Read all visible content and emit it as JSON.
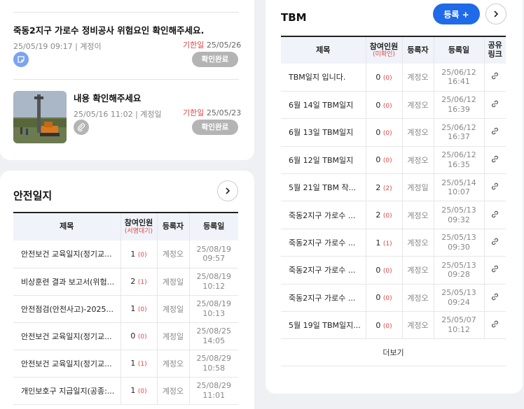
{
  "notices": [
    {
      "title": "죽동2지구 가로수 정비공사 위험요인 확인해주세요.",
      "meta": "25/05/19 09:17 | 계정이",
      "due_label": "기한일",
      "due": "25/05/26",
      "status": "확인완료",
      "attachment_icon": "memo-icon"
    },
    {
      "title": "내용 확인해주세요",
      "meta": "25/05/16 11:02 | 계정일",
      "due_label": "기한일",
      "due": "25/05/23",
      "status": "확인완료",
      "attachment_icon": "paperclip-icon"
    }
  ],
  "safety": {
    "title": "안전일지",
    "columns": {
      "title": "제목",
      "participants": "참여인원",
      "participants_sub": "(서명대기)",
      "registrant": "등록자",
      "date": "등록일"
    },
    "rows": [
      {
        "title": "안전보건 교육일지(정기교...",
        "count": "1",
        "pending": "(0)",
        "registrant": "계정오",
        "date": "25/08/19",
        "time": "09:57"
      },
      {
        "title": "비상훈련 결과 보고서(위험...",
        "count": "2",
        "pending": "(1)",
        "registrant": "계정일",
        "date": "25/08/19",
        "time": "10:12"
      },
      {
        "title": "안전점검(안전사고)-2025...",
        "count": "1",
        "pending": "(0)",
        "registrant": "계정일",
        "date": "25/08/19",
        "time": "10:13"
      },
      {
        "title": "안전보건 교육일지(정기교...",
        "count": "0",
        "pending": "(0)",
        "registrant": "계정일",
        "date": "25/08/25",
        "time": "14:05"
      },
      {
        "title": "안전보건 교육일지(정기교...",
        "count": "1",
        "pending": "(1)",
        "registrant": "계정오",
        "date": "25/08/29",
        "time": "10:58"
      },
      {
        "title": "개인보호구 지급일지(공종:...",
        "count": "1",
        "pending": "(0)",
        "registrant": "계정오",
        "date": "25/08/29",
        "time": "11:01"
      }
    ]
  },
  "tbm": {
    "title": "TBM",
    "register_label": "등록 +",
    "columns": {
      "title": "제목",
      "participants": "참여인원",
      "participants_sub": "(미확인)",
      "registrant": "등록자",
      "date": "등록일",
      "share_1": "공유",
      "share_2": "링크"
    },
    "rows": [
      {
        "title": "TBM일지 입니다.",
        "count": "0",
        "pending": "(0)",
        "registrant": "계정오",
        "date": "25/06/12",
        "time": "16:41"
      },
      {
        "title": "6월 14일 TBM일지",
        "count": "0",
        "pending": "(0)",
        "registrant": "계정오",
        "date": "25/06/12",
        "time": "16:39"
      },
      {
        "title": "6월 13일 TBM일지",
        "count": "0",
        "pending": "(0)",
        "registrant": "계정오",
        "date": "25/06/12",
        "time": "16:37"
      },
      {
        "title": "6월 12일 TBM일지",
        "count": "0",
        "pending": "(0)",
        "registrant": "계정오",
        "date": "25/06/12",
        "time": "16:35"
      },
      {
        "title": "5월 21일 TBM 작...",
        "count": "2",
        "pending": "(2)",
        "registrant": "계정일",
        "date": "25/05/14",
        "time": "10:07"
      },
      {
        "title": "죽동2지구 가로수 ...",
        "count": "2",
        "pending": "(0)",
        "registrant": "계정오",
        "date": "25/05/13",
        "time": "09:32"
      },
      {
        "title": "죽동2지구 가로수 ...",
        "count": "1",
        "pending": "(1)",
        "registrant": "계정오",
        "date": "25/05/13",
        "time": "09:30"
      },
      {
        "title": "죽동2지구 가로수 ...",
        "count": "0",
        "pending": "(0)",
        "registrant": "계정오",
        "date": "25/05/13",
        "time": "09:28"
      },
      {
        "title": "죽동2지구 가로수 ...",
        "count": "0",
        "pending": "(0)",
        "registrant": "계정오",
        "date": "25/05/13",
        "time": "09:24"
      },
      {
        "title": "5월 19일 TBM일지...",
        "count": "0",
        "pending": "(0)",
        "registrant": "계정오",
        "date": "25/05/07",
        "time": "10:12"
      }
    ],
    "more_label": "더보기"
  },
  "colors": {
    "accent": "#1f6ae8",
    "danger": "#e04545",
    "chip": "#b4b4b4",
    "memo_icon_bg": "#7aa3f0"
  }
}
